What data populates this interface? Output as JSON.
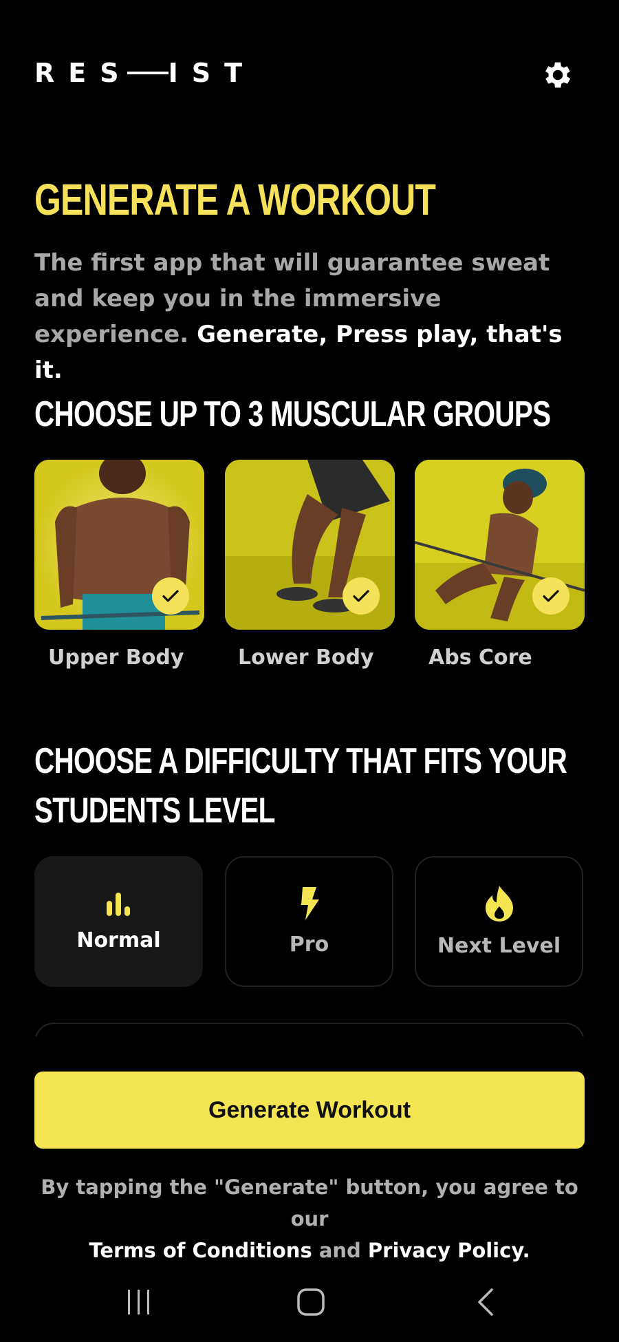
{
  "header": {
    "logo_left": "RES",
    "logo_right": "IST",
    "settings_icon": "gear-icon"
  },
  "title": "GENERATE A WORKOUT",
  "subtitle": {
    "line1": "The first app that will guarantee sweat and keep you in the immersive experience.",
    "line2": "Generate, Press play, that's it."
  },
  "muscle_section": {
    "heading": "CHOOSE UP TO 3 MUSCULAR GROUPS",
    "groups": [
      {
        "label": "Upper Body",
        "selected": true
      },
      {
        "label": "Lower Body",
        "selected": true
      },
      {
        "label": "Abs Core",
        "selected": true
      }
    ]
  },
  "difficulty_section": {
    "heading_line1": "CHOOSE A DIFFICULTY THAT FITS YOUR",
    "heading_line2": "STUDENTS LEVEL",
    "options": [
      {
        "label": "Normal",
        "icon": "bar-chart-icon",
        "selected": true
      },
      {
        "label": "Pro",
        "icon": "lightning-icon",
        "selected": false
      },
      {
        "label": "Next Level",
        "icon": "flame-icon",
        "selected": false
      }
    ]
  },
  "generate_button": "Generate Workout",
  "legal": {
    "prefix": "By tapping the \"Generate\" button, you agree to our",
    "terms": "Terms of Conditions",
    "and": "and",
    "privacy": "Privacy Policy",
    "period": "."
  },
  "colors": {
    "accent": "#f5e553",
    "background": "#000000"
  }
}
